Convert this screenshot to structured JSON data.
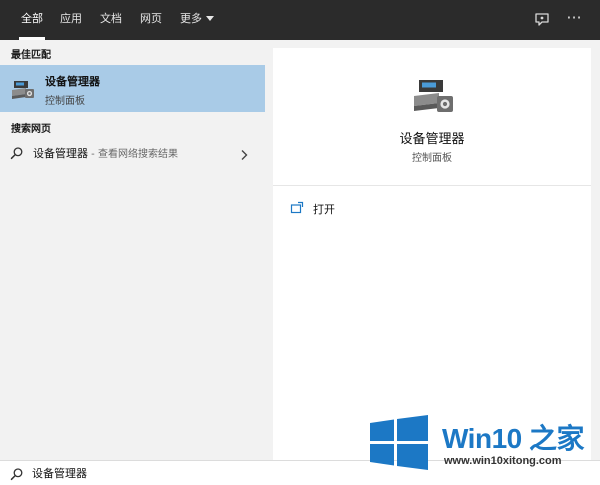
{
  "tabs": [
    {
      "label": "全部",
      "active": true
    },
    {
      "label": "应用",
      "active": false
    },
    {
      "label": "文档",
      "active": false
    },
    {
      "label": "网页",
      "active": false
    },
    {
      "label": "更多",
      "active": false
    }
  ],
  "topbar_icons": [
    "feedback-icon",
    "more-options-icon"
  ],
  "more_symbol": "···",
  "left": {
    "best_match_header": "最佳匹配",
    "best_match": {
      "title": "设备管理器",
      "subtitle": "控制面板",
      "icon": "device-manager-icon"
    },
    "web_header": "搜索网页",
    "web_result": {
      "query": "设备管理器",
      "suffix": " - 查看网络搜索结果"
    }
  },
  "right": {
    "title": "设备管理器",
    "subtitle": "控制面板",
    "actions": [
      {
        "label": "打开",
        "icon": "open-icon"
      }
    ]
  },
  "search": {
    "value": "设备管理器"
  },
  "watermark": {
    "brand_a": "Win10",
    "brand_b": " 之家",
    "url": "www.win10xitong.com"
  },
  "colors": {
    "topbar": "#2b2b2b",
    "panel": "#f2f2f2",
    "selected": "#a9cbe7",
    "brand": "#1c78c5"
  }
}
